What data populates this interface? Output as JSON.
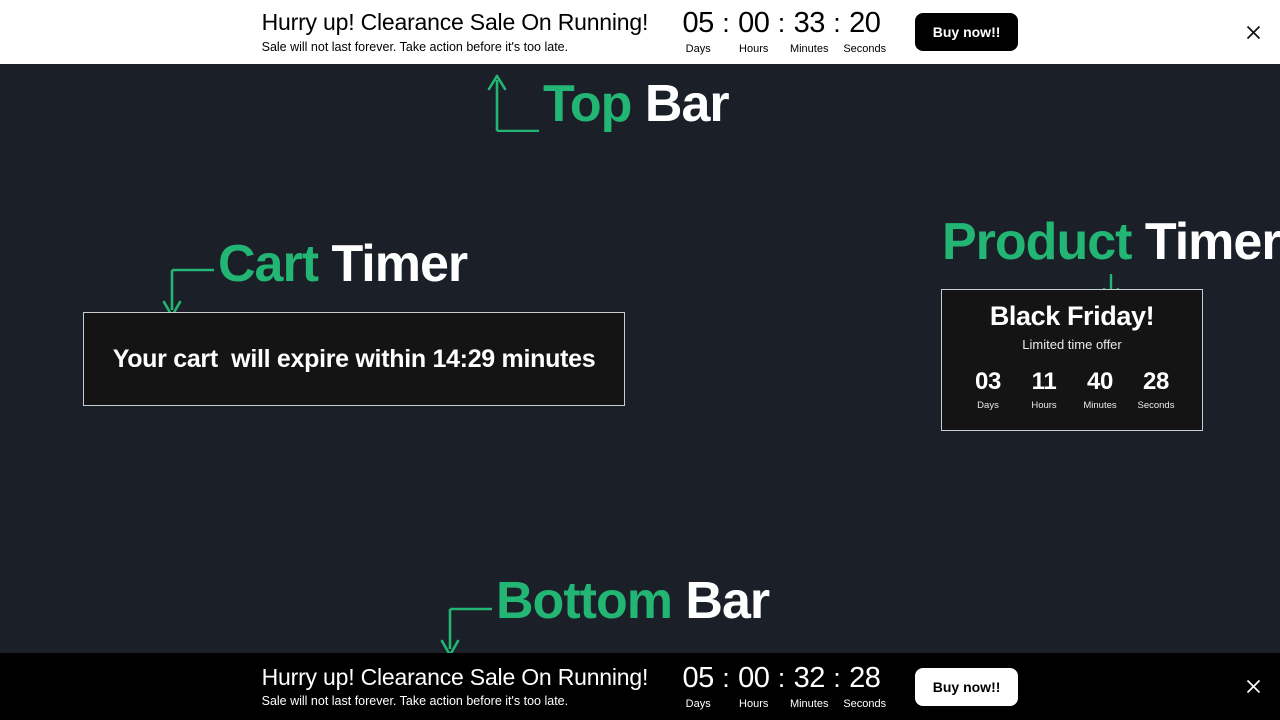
{
  "page": {
    "background_color": "#1b1f28",
    "accent_color": "#22b573"
  },
  "top_bar": {
    "headline": "Hurry up! Clearance Sale On Running!",
    "subtext": "Sale will not last forever. Take action before it's too late.",
    "cta_label": "Buy now!!",
    "close_icon": "close-icon",
    "separator": ":",
    "countdown": [
      {
        "value": "05",
        "label": "Days"
      },
      {
        "value": "00",
        "label": "Hours"
      },
      {
        "value": "33",
        "label": "Minutes"
      },
      {
        "value": "20",
        "label": "Seconds"
      }
    ]
  },
  "bottom_bar": {
    "headline": "Hurry up! Clearance Sale On Running!",
    "subtext": "Sale will not last forever. Take action before it's too late.",
    "cta_label": "Buy now!!",
    "close_icon": "close-icon",
    "separator": ":",
    "countdown": [
      {
        "value": "05",
        "label": "Days"
      },
      {
        "value": "00",
        "label": "Hours"
      },
      {
        "value": "32",
        "label": "Minutes"
      },
      {
        "value": "28",
        "label": "Seconds"
      }
    ]
  },
  "annotations": {
    "top": {
      "accent": "Top",
      "plain": " Bar",
      "arrow_icon": "elbow-arrow-up-icon"
    },
    "cart": {
      "accent": "Cart",
      "plain": " Timer",
      "arrow_icon": "elbow-arrow-down-left-icon"
    },
    "product": {
      "accent": "Product",
      "plain": " Timer",
      "arrow_icon": "arrow-down-icon"
    },
    "bottom": {
      "accent": "Bottom",
      "plain": " Bar",
      "arrow_icon": "elbow-arrow-down-left-icon"
    }
  },
  "cart_timer": {
    "message": "Your cart  will expire within 14:29 minutes"
  },
  "product_timer": {
    "title": "Black Friday!",
    "subtitle": "Limited time offer",
    "countdown": [
      {
        "value": "03",
        "label": "Days"
      },
      {
        "value": "11",
        "label": "Hours"
      },
      {
        "value": "40",
        "label": "Minutes"
      },
      {
        "value": "28",
        "label": "Seconds"
      }
    ]
  }
}
